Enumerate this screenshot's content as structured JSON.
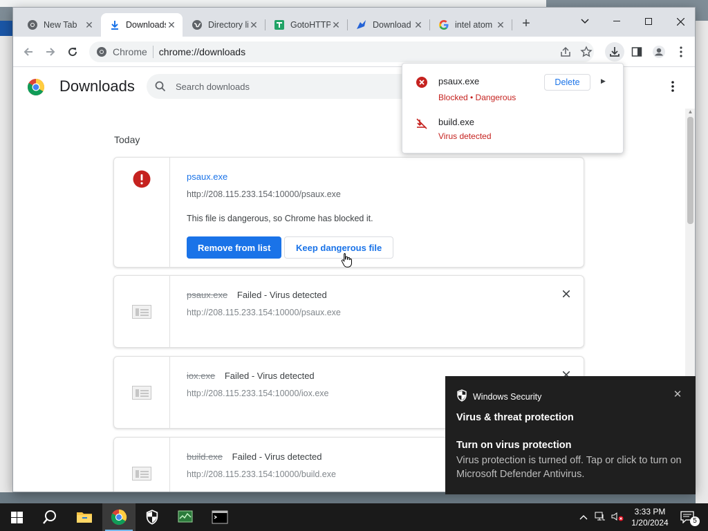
{
  "browser": {
    "tabs": [
      {
        "title": "New Tab",
        "icon": "chrome-icon"
      },
      {
        "title": "Downloads",
        "icon": "download-icon",
        "active": true
      },
      {
        "title": "Directory listing",
        "icon": "globe-icon"
      },
      {
        "title": "GotoHTTP",
        "icon": "gotohttp-icon"
      },
      {
        "title": "Download",
        "icon": "bird-icon"
      },
      {
        "title": "intel atom",
        "icon": "google-icon"
      }
    ],
    "omnibox": {
      "chip": "Chrome",
      "url": "chrome://downloads"
    }
  },
  "downloads_page": {
    "title": "Downloads",
    "search_placeholder": "Search downloads",
    "section_date": "Today",
    "items": [
      {
        "filename": "psaux.exe",
        "url": "http://208.115.233.154:10000/psaux.exe",
        "message": "This file is dangerous, so Chrome has blocked it.",
        "primary_button": "Remove from list",
        "secondary_button": "Keep dangerous file"
      },
      {
        "filename": "psaux.exe",
        "status": "Failed - Virus detected",
        "url": "http://208.115.233.154:10000/psaux.exe"
      },
      {
        "filename": "iox.exe",
        "status": "Failed - Virus detected",
        "url": "http://208.115.233.154:10000/iox.exe"
      },
      {
        "filename": "build.exe",
        "status": "Failed - Virus detected",
        "url": "http://208.115.233.154:10000/build.exe"
      }
    ]
  },
  "download_bubble": {
    "items": [
      {
        "filename": "psaux.exe",
        "status": "Blocked • Dangerous",
        "button": "Delete"
      },
      {
        "filename": "build.exe",
        "status": "Virus detected"
      }
    ]
  },
  "toast": {
    "app": "Windows Security",
    "title": "Virus & threat protection",
    "subtitle": "Turn on virus protection",
    "body": "Virus protection is turned off. Tap or click to turn on Microsoft Defender Antivirus."
  },
  "taskbar": {
    "time": "3:33 PM",
    "date": "1/20/2024",
    "notification_count": "5"
  },
  "colors": {
    "accent": "#1a73e8",
    "danger": "#c5221f",
    "toast_bg": "#1f1f1f",
    "taskbar_bg": "#1a1a1a"
  }
}
